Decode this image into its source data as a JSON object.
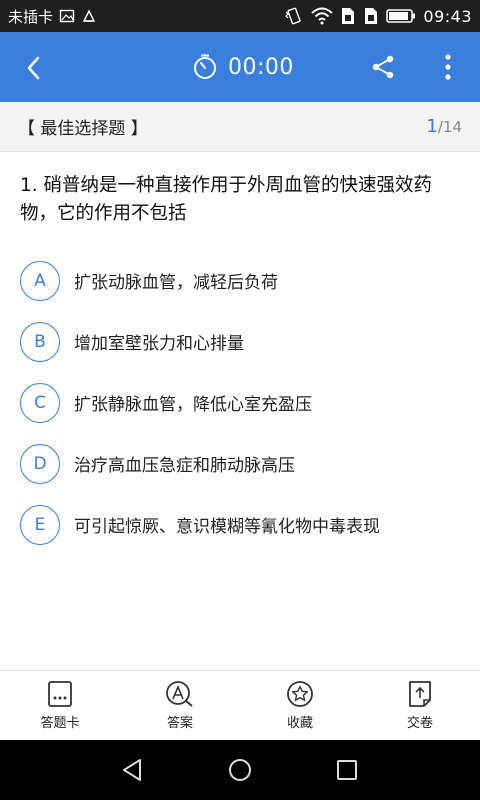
{
  "status_bar": {
    "carrier": "未插卡",
    "time": "09:43",
    "icons": [
      "image-icon",
      "usb-icon",
      "vibrate-icon",
      "wifi-icon",
      "sim-icon",
      "sim2-icon",
      "battery-icon"
    ]
  },
  "app_bar": {
    "timer": "00:00",
    "accent": "#3a7fdc",
    "icons": [
      "back-icon",
      "stopwatch-icon",
      "share-icon",
      "more-vert-icon"
    ]
  },
  "section": {
    "title": "【 最佳选择题 】",
    "current": "1",
    "total": "/14"
  },
  "question": {
    "text": "1. 硝普纳是一种直接作用于外周血管的快速强效药物，它的作用不包括"
  },
  "options": [
    {
      "letter": "A",
      "text": "扩张动脉血管，减轻后负荷"
    },
    {
      "letter": "B",
      "text": "增加室壁张力和心排量"
    },
    {
      "letter": "C",
      "text": "扩张静脉血管，降低心室充盈压"
    },
    {
      "letter": "D",
      "text": "治疗高血压急症和肺动脉高压"
    },
    {
      "letter": "E",
      "text": "可引起惊厥、意识模糊等氰化物中毒表现"
    }
  ],
  "toolbar": {
    "answer_card": "答题卡",
    "answer": "答案",
    "favorite": "收藏",
    "submit": "交卷"
  },
  "nav_bar": {
    "icons": [
      "back-triangle-icon",
      "home-circle-icon",
      "recents-square-icon"
    ]
  }
}
